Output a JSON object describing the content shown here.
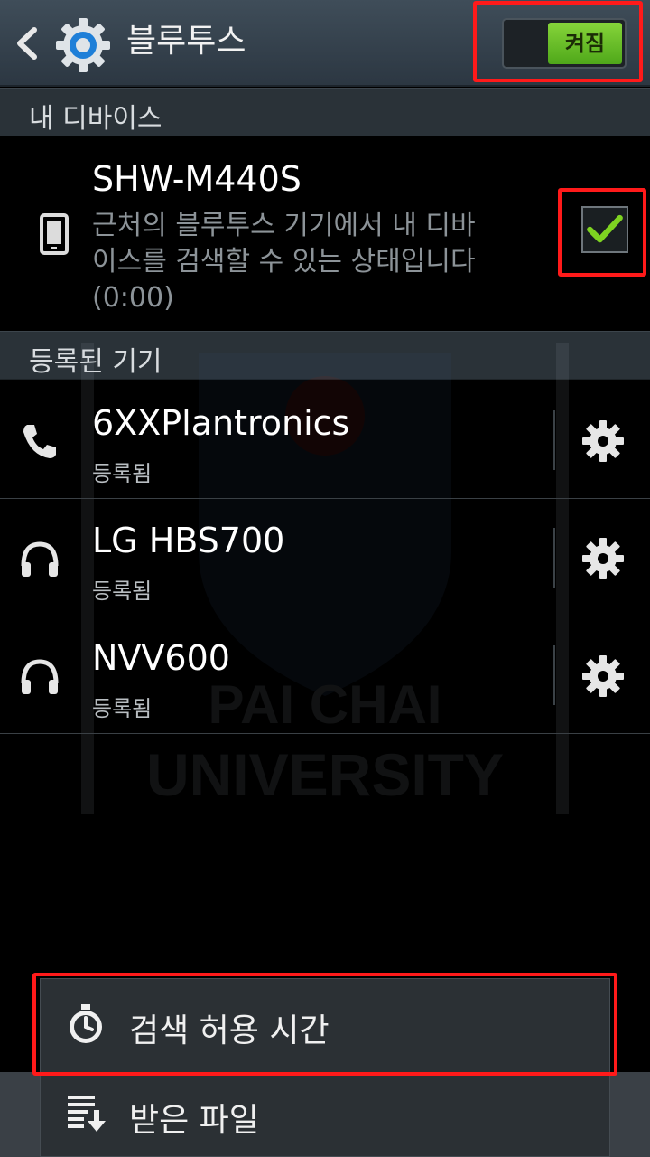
{
  "actionbar": {
    "title": "블루투스",
    "toggle_label": "켜짐"
  },
  "sections": {
    "my_device": "내 디바이스",
    "paired": "등록된 기기"
  },
  "my_device": {
    "name": "SHW-M440S",
    "description": "근처의 블루투스 기기에서 내 디바이스를 검색할 수 있는 상태입니다(0:00)",
    "visible_checked": true
  },
  "paired_devices": [
    {
      "name": "6XXPlantronics",
      "status": "등록됨",
      "icon": "phone-icon"
    },
    {
      "name": "LG HBS700",
      "status": "등록됨",
      "icon": "headphones-icon"
    },
    {
      "name": "NVV600",
      "status": "등록됨",
      "icon": "headphones-icon"
    }
  ],
  "menu": {
    "items": [
      {
        "label": "검색 허용 시간",
        "icon": "stopwatch-icon"
      },
      {
        "label": "받은 파일",
        "icon": "download-list-icon"
      }
    ]
  },
  "watermark": {
    "line1": "PAI CHAI",
    "line2": "UNIVERSITY"
  },
  "colors": {
    "toggle_on": "#6cc229",
    "checkmark": "#7ed321",
    "highlight": "#ff1a1a",
    "section_bg": "#2a3238"
  }
}
